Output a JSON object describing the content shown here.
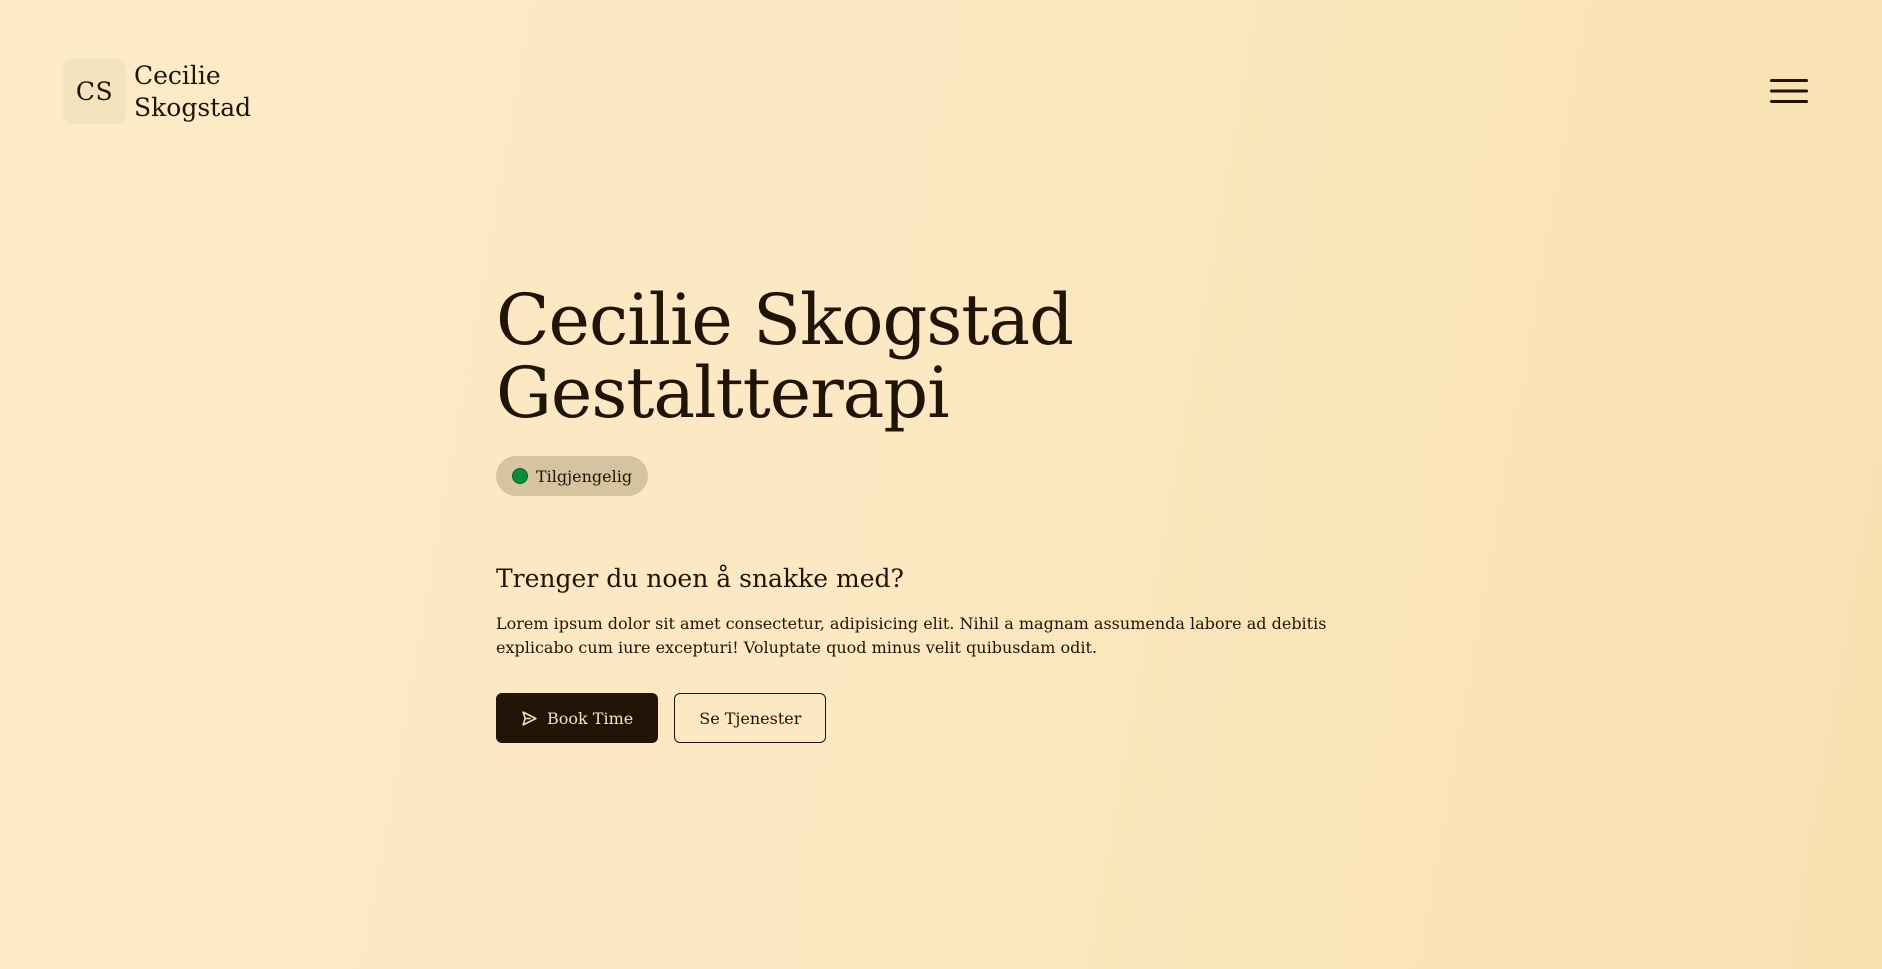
{
  "header": {
    "logo_initials": "CS",
    "logo_name_line1": "Cecilie",
    "logo_name_line2": "Skogstad",
    "menu_icon": "hamburger-menu-icon"
  },
  "hero": {
    "title_line1": "Cecilie Skogstad",
    "title_line2": "Gestaltterapi",
    "status": {
      "label": "Tilgjengelig",
      "color": "#0b8a3c"
    },
    "subheading": "Trenger du noen å snakke med?",
    "description": "Lorem ipsum dolor sit amet consectetur, adipisicing elit. Nihil a magnam assumenda labore ad debitis explicabo cum iure excepturi! Voluptate quod minus velit quibusdam odit.",
    "primary_button": {
      "label": "Book Time",
      "icon": "send-icon"
    },
    "secondary_button": {
      "label": "Se Tjenester"
    }
  },
  "colors": {
    "background": "#fce8c2",
    "text": "#1f1405",
    "primary_button_bg": "#1f1405",
    "primary_button_text": "#f8e3b5",
    "badge_bg": "#d6c3a0"
  }
}
